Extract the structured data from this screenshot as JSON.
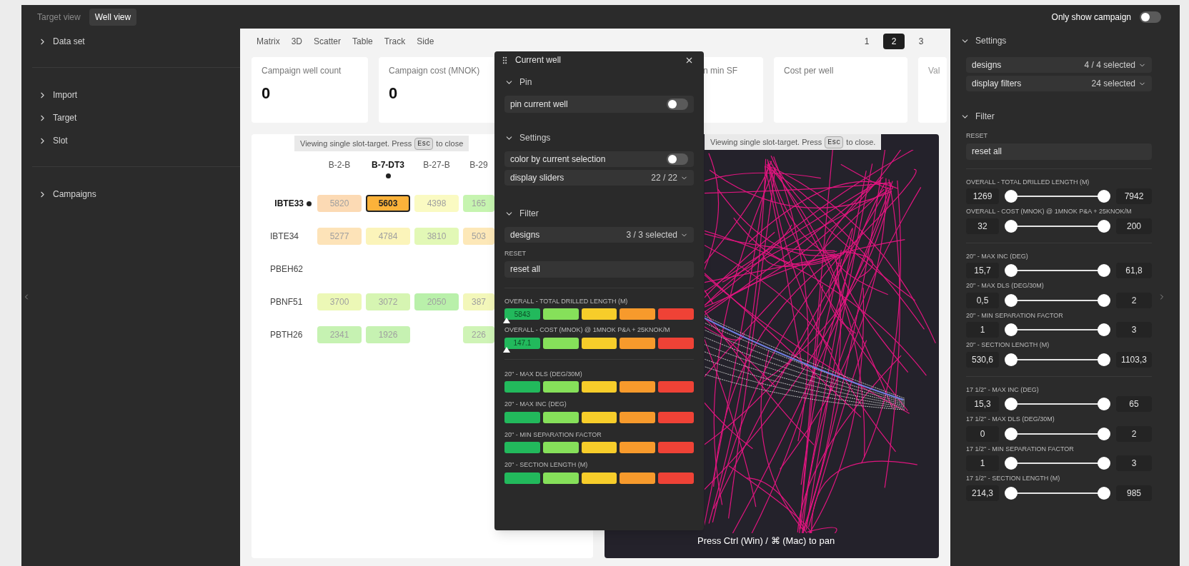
{
  "view_tabs": [
    {
      "label": "Target view",
      "selected": false
    },
    {
      "label": "Well view",
      "selected": true
    }
  ],
  "campaign_toggle": {
    "label": "Only show campaign",
    "on": false
  },
  "sidebar": {
    "groups": [
      {
        "items": [
          {
            "label": "Data set",
            "expanded": false
          }
        ]
      },
      {
        "items": [
          {
            "label": "Import",
            "expanded": false
          },
          {
            "label": "Target",
            "expanded": false
          },
          {
            "label": "Slot",
            "expanded": false
          }
        ]
      },
      {
        "items": [
          {
            "label": "Campaigns",
            "expanded": false
          }
        ]
      }
    ]
  },
  "main": {
    "tabs": [
      {
        "label": "Matrix",
        "selected": false
      },
      {
        "label": "3D",
        "selected": false
      },
      {
        "label": "Scatter",
        "selected": false
      },
      {
        "label": "Table",
        "selected": false
      },
      {
        "label": "Track",
        "selected": false
      },
      {
        "label": "Side",
        "selected": false
      }
    ],
    "pages": [
      {
        "label": "1",
        "selected": false
      },
      {
        "label": "2",
        "selected": true
      },
      {
        "label": "3",
        "selected": false
      }
    ],
    "kpis": [
      {
        "label": "Campaign well count",
        "value": "0"
      },
      {
        "label": "Campaign cost (MNOK)",
        "value": "0"
      },
      {
        "label": "n min SF"
      },
      {
        "label": "Cost per well"
      },
      {
        "label": "Val"
      }
    ],
    "matrix": {
      "notice": {
        "text": "Viewing single slot-target. Press",
        "key": "Esc",
        "after": "to close"
      },
      "columns": [
        {
          "label": "B-2-B",
          "selected": false
        },
        {
          "label": "B-7-DT3",
          "selected": true
        },
        {
          "label": "B-27-B",
          "selected": false
        },
        {
          "label": "B-29",
          "selected": false
        }
      ],
      "rows": [
        {
          "label": "IBTE33",
          "selected": true,
          "cells": [
            {
              "value": "5820",
              "color": "#fcdab4",
              "selected": false
            },
            {
              "value": "5603",
              "color": "#fbb23a",
              "selected": true
            },
            {
              "value": "4398",
              "color": "#fafac2",
              "selected": false
            },
            {
              "value": "165",
              "color": "#c6f4b0",
              "selected": false
            }
          ]
        },
        {
          "label": "IBTE34",
          "selected": false,
          "cells": [
            {
              "value": "5277",
              "color": "#fde3b8",
              "selected": false
            },
            {
              "value": "4784",
              "color": "#fbf4ba",
              "selected": false
            },
            {
              "value": "3810",
              "color": "#e2f8b6",
              "selected": false
            },
            {
              "value": "503",
              "color": "#fde8b8",
              "selected": false
            }
          ]
        },
        {
          "label": "PBEH62",
          "selected": false
        },
        {
          "label": "PBNF51",
          "selected": false,
          "cells": [
            {
              "value": "3700",
              "color": "#ecf8b6",
              "selected": false
            },
            {
              "value": "3072",
              "color": "#d6f5b2",
              "selected": false
            },
            {
              "value": "2050",
              "color": "#b9f0aa",
              "selected": false
            },
            {
              "value": "387",
              "color": "#f3f7ba",
              "selected": false
            }
          ]
        },
        {
          "label": "PBTH26",
          "selected": false,
          "cells": [
            {
              "value": "2341",
              "color": "#c6f2b2",
              "selected": false
            },
            {
              "value": "1926",
              "color": "#c6f2b2",
              "selected": false
            },
            null,
            {
              "value": "226",
              "color": "#cff4b6",
              "selected": false
            }
          ]
        }
      ]
    },
    "view3d": {
      "notice": {
        "text": "Viewing single slot-target. Press",
        "key": "Esc",
        "after": "to close."
      },
      "hint": "Press Ctrl (Win) / ⌘ (Mac) to pan"
    }
  },
  "current_well": {
    "title": "Current well",
    "pin": {
      "title": "Pin",
      "expanded": true,
      "toggle": {
        "label": "pin current well",
        "on": false
      }
    },
    "settings": {
      "title": "Settings",
      "expanded": true,
      "toggle": {
        "label": "color by current selection",
        "on": false
      },
      "select": {
        "label": "display sliders",
        "value": "22 / 22"
      }
    },
    "filter": {
      "title": "Filter",
      "expanded": true,
      "select": {
        "label": "designs",
        "value": "3 / 3 selected"
      },
      "reset_label": "RESET",
      "reset_button": "reset all",
      "scale_colors": [
        {
          "color": "#22b95c"
        },
        {
          "color": "#86e05a"
        },
        {
          "color": "#f7cd2a"
        },
        {
          "color": "#f79a2c"
        },
        {
          "color": "#ef4236"
        }
      ],
      "bar_groups": [
        {
          "bars": [
            {
              "label": "OVERALL - TOTAL DRILLED LENGTH (M)",
              "value": "5843",
              "level": 0
            },
            {
              "label": "OVERALL - COST (MNOK) @ 1MNOK P&A + 25KNOK/M",
              "value": "147.1",
              "level": 0
            }
          ]
        },
        {
          "bars": [
            {
              "label": "20\" - MAX DLS (DEG/30M)"
            },
            {
              "label": "20\" - MAX INC (DEG)"
            },
            {
              "label": "20\" - MIN SEPARATION FACTOR"
            },
            {
              "label": "20\" - SECTION LENGTH (M)"
            }
          ]
        }
      ]
    }
  },
  "right_panel": {
    "settings": {
      "title": "Settings",
      "expanded": true,
      "selects": [
        {
          "label": "designs",
          "value": "4 / 4 selected"
        },
        {
          "label": "display filters",
          "value": "24 selected"
        }
      ]
    },
    "filter": {
      "title": "Filter",
      "expanded": true,
      "reset_label": "RESET",
      "reset_button": "reset all",
      "slider_groups": [
        {
          "sliders": [
            {
              "label": "OVERALL - TOTAL DRILLED LENGTH (M)",
              "min": "1269",
              "max": "7942",
              "thumbs": [
                {
                  "level": 0
                },
                {
                  "level": 1
                }
              ]
            },
            {
              "label": "OVERALL - COST (MNOK) @ 1MNOK P&A + 25KNOK/M",
              "min": "32",
              "max": "200",
              "thumbs": [
                {
                  "level": 0
                },
                {
                  "level": 1
                }
              ]
            }
          ]
        },
        {
          "sliders": [
            {
              "label": "20\" - MAX INC (DEG)",
              "min": "15,7",
              "max": "61,8",
              "thumbs": [
                {
                  "level": 0
                },
                {
                  "level": 1
                }
              ]
            },
            {
              "label": "20\" - MAX DLS (DEG/30M)",
              "min": "0,5",
              "max": "2",
              "thumbs": [
                {
                  "level": 0
                },
                {
                  "level": 1
                }
              ]
            },
            {
              "label": "20\" - MIN SEPARATION FACTOR",
              "min": "1",
              "max": "3",
              "thumbs": [
                {
                  "level": 0
                },
                {
                  "level": 1
                }
              ]
            },
            {
              "label": "20\" - SECTION LENGTH (M)",
              "min": "530,6",
              "max": "1103,3",
              "thumbs": [
                {
                  "level": 0
                },
                {
                  "level": 1
                }
              ]
            }
          ]
        },
        {
          "sliders": [
            {
              "label": "17 1/2\" - MAX INC (DEG)",
              "min": "15,3",
              "max": "65",
              "thumbs": [
                {
                  "level": 0
                },
                {
                  "level": 1
                }
              ]
            },
            {
              "label": "17 1/2\" - MAX DLS (DEG/30M)",
              "min": "0",
              "max": "2",
              "thumbs": [
                {
                  "level": 0
                },
                {
                  "level": 1
                }
              ]
            },
            {
              "label": "17 1/2\" - MIN SEPARATION FACTOR",
              "min": "1",
              "max": "3",
              "thumbs": [
                {
                  "level": 0
                },
                {
                  "level": 1
                }
              ]
            },
            {
              "label": "17 1/2\" - SECTION LENGTH (M)",
              "min": "214,3",
              "max": "985",
              "thumbs": [
                {
                  "level": 0
                },
                {
                  "level": 1
                }
              ]
            }
          ]
        }
      ]
    }
  }
}
